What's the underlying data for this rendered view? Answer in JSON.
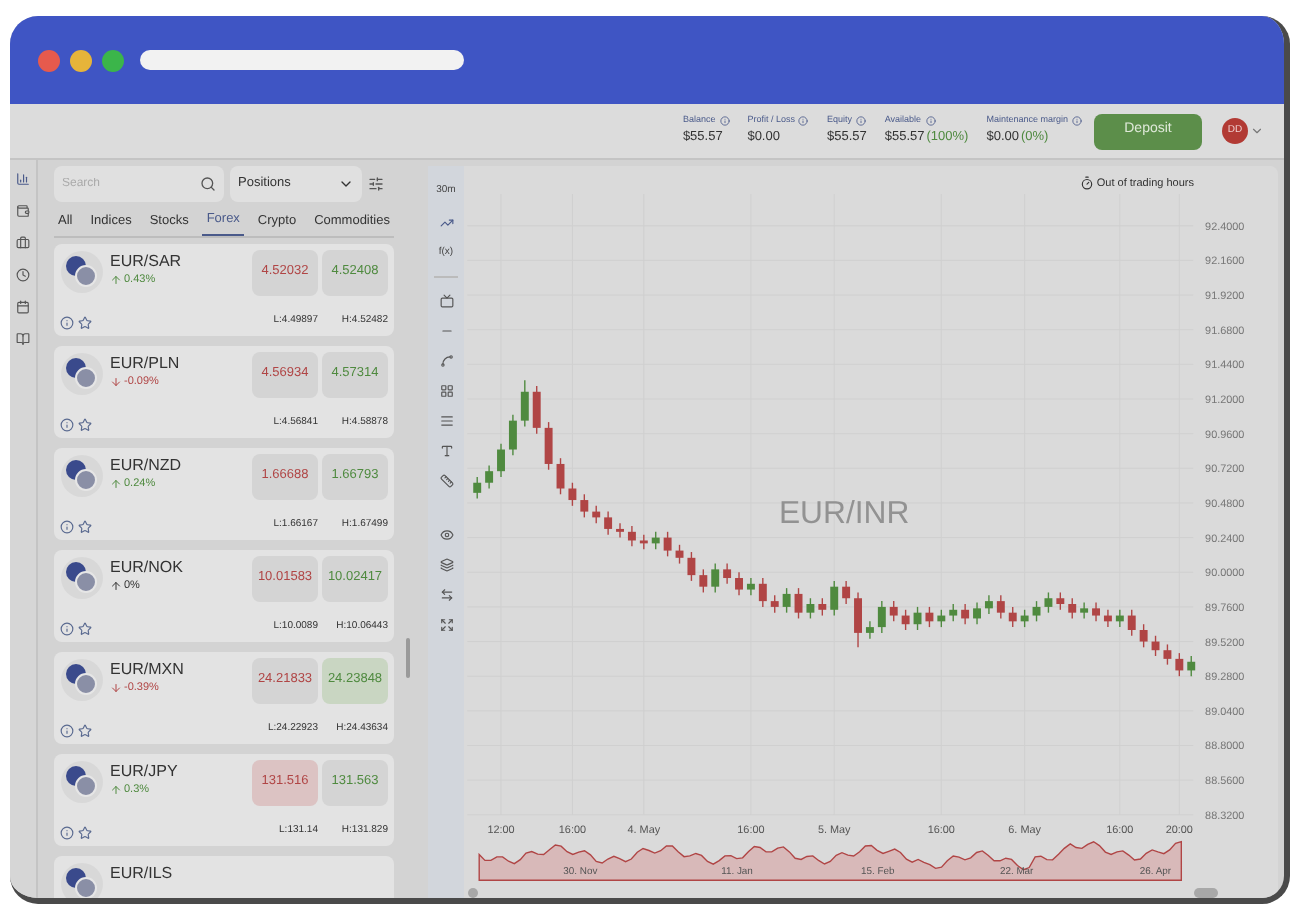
{
  "account": [
    {
      "label": "Balance",
      "value": "$55.57"
    },
    {
      "label": "Profit / Loss",
      "value": "$0.00"
    },
    {
      "label": "Equity",
      "value": "$55.57"
    },
    {
      "label": "Available",
      "value": "$55.57",
      "percent": "(100%)"
    },
    {
      "label": "Maintenance margin",
      "value": "$0.00",
      "percent": "(0%)"
    }
  ],
  "deposit_button": "Deposit",
  "avatar": "DD",
  "search": {
    "placeholder": "Search"
  },
  "view_select": "Positions",
  "tabs": [
    {
      "label": "All",
      "selected": false
    },
    {
      "label": "Indices",
      "selected": false
    },
    {
      "label": "Stocks",
      "selected": false
    },
    {
      "label": "Forex",
      "selected": true
    },
    {
      "label": "Crypto",
      "selected": false
    },
    {
      "label": "Commodities",
      "selected": false
    }
  ],
  "instruments": [
    {
      "pair": "EUR/SAR",
      "change": "0.43%",
      "falling": false,
      "unchanged": false,
      "sell": {
        "price": "4.52032",
        "highlighted": false
      },
      "buy": {
        "price": "4.52408",
        "highlighted": false
      },
      "low": "L:4.49897",
      "high": "H:4.52482"
    },
    {
      "pair": "EUR/PLN",
      "change": "-0.09%",
      "falling": true,
      "unchanged": false,
      "sell": {
        "price": "4.56934",
        "highlighted": false
      },
      "buy": {
        "price": "4.57314",
        "highlighted": false
      },
      "low": "L:4.56841",
      "high": "H:4.58878"
    },
    {
      "pair": "EUR/NZD",
      "change": "0.24%",
      "falling": false,
      "unchanged": false,
      "sell": {
        "price": "1.66688",
        "highlighted": false
      },
      "buy": {
        "price": "1.66793",
        "highlighted": false
      },
      "low": "L:1.66167",
      "high": "H:1.67499"
    },
    {
      "pair": "EUR/NOK",
      "change": "0%",
      "falling": false,
      "unchanged": true,
      "sell": {
        "price": "10.01583",
        "highlighted": false
      },
      "buy": {
        "price": "10.02417",
        "highlighted": false
      },
      "low": "L:10.0089",
      "high": "H:10.06443"
    },
    {
      "pair": "EUR/MXN",
      "change": "-0.39%",
      "falling": true,
      "unchanged": false,
      "sell": {
        "price": "24.21833",
        "highlighted": false
      },
      "buy": {
        "price": "24.23848",
        "highlighted": true
      },
      "low": "L:24.22923",
      "high": "H:24.43634"
    },
    {
      "pair": "EUR/JPY",
      "change": "0.3%",
      "falling": false,
      "unchanged": false,
      "sell": {
        "price": "131.516",
        "highlighted": true
      },
      "buy": {
        "price": "131.563",
        "highlighted": false
      },
      "low": "L:131.14",
      "high": "H:131.829"
    },
    {
      "pair": "EUR/ILS"
    }
  ],
  "chart": {
    "interval": "30m",
    "indicator_button": "f(x)",
    "status": "Out of trading hours",
    "watermark": "EUR/INR",
    "chart_data": {
      "type": "candlestick",
      "categories": [
        null,
        null,
        "12:00",
        null,
        null,
        null,
        null,
        null,
        "16:00",
        null,
        null,
        null,
        null,
        null,
        "4. May",
        null,
        null,
        null,
        null,
        null,
        null,
        null,
        null,
        "16:00",
        null,
        null,
        null,
        null,
        null,
        null,
        "5. May",
        null,
        null,
        null,
        null,
        null,
        null,
        null,
        null,
        "16:00",
        null,
        null,
        null,
        null,
        null,
        null,
        "6. May",
        null,
        null,
        null,
        null,
        null,
        null,
        null,
        "16:00",
        null,
        null,
        null,
        null,
        "20:00",
        null
      ],
      "ohlc": [
        [
          90.55,
          90.66,
          90.51,
          90.62
        ],
        [
          90.62,
          90.74,
          90.58,
          90.7
        ],
        [
          90.7,
          90.89,
          90.66,
          90.85
        ],
        [
          90.85,
          91.09,
          90.81,
          91.05
        ],
        [
          91.05,
          91.33,
          91.01,
          91.25
        ],
        [
          91.25,
          91.29,
          90.96,
          91.0
        ],
        [
          91.0,
          91.04,
          90.71,
          90.75
        ],
        [
          90.75,
          90.79,
          90.54,
          90.58
        ],
        [
          90.58,
          90.62,
          90.46,
          90.5
        ],
        [
          90.5,
          90.54,
          90.38,
          90.42
        ],
        [
          90.42,
          90.46,
          90.34,
          90.38
        ],
        [
          90.38,
          90.42,
          90.26,
          90.3
        ],
        [
          90.3,
          90.34,
          90.24,
          90.28
        ],
        [
          90.28,
          90.32,
          90.18,
          90.22
        ],
        [
          90.22,
          90.26,
          90.16,
          90.2
        ],
        [
          90.2,
          90.28,
          90.16,
          90.24
        ],
        [
          90.24,
          90.28,
          90.11,
          90.15
        ],
        [
          90.15,
          90.19,
          90.06,
          90.1
        ],
        [
          90.1,
          90.14,
          89.94,
          89.98
        ],
        [
          89.98,
          90.02,
          89.86,
          89.9
        ],
        [
          89.9,
          90.06,
          89.86,
          90.02
        ],
        [
          90.02,
          90.06,
          89.92,
          89.96
        ],
        [
          89.96,
          90.0,
          89.84,
          89.88
        ],
        [
          89.88,
          89.96,
          89.84,
          89.92
        ],
        [
          89.92,
          89.96,
          89.76,
          89.8
        ],
        [
          89.8,
          89.84,
          89.72,
          89.76
        ],
        [
          89.76,
          89.89,
          89.72,
          89.85
        ],
        [
          89.85,
          89.89,
          89.68,
          89.72
        ],
        [
          89.72,
          89.82,
          89.68,
          89.78
        ],
        [
          89.78,
          89.82,
          89.7,
          89.74
        ],
        [
          89.74,
          89.94,
          89.7,
          89.9
        ],
        [
          89.9,
          89.94,
          89.78,
          89.82
        ],
        [
          89.82,
          89.86,
          89.48,
          89.58
        ],
        [
          89.58,
          89.66,
          89.54,
          89.62
        ],
        [
          89.62,
          89.8,
          89.58,
          89.76
        ],
        [
          89.76,
          89.8,
          89.66,
          89.7
        ],
        [
          89.7,
          89.74,
          89.6,
          89.64
        ],
        [
          89.64,
          89.76,
          89.6,
          89.72
        ],
        [
          89.72,
          89.76,
          89.62,
          89.66
        ],
        [
          89.66,
          89.74,
          89.62,
          89.7
        ],
        [
          89.7,
          89.78,
          89.66,
          89.74
        ],
        [
          89.74,
          89.78,
          89.64,
          89.68
        ],
        [
          89.68,
          89.79,
          89.64,
          89.75
        ],
        [
          89.75,
          89.84,
          89.71,
          89.8
        ],
        [
          89.8,
          89.84,
          89.68,
          89.72
        ],
        [
          89.72,
          89.76,
          89.62,
          89.66
        ],
        [
          89.66,
          89.74,
          89.62,
          89.7
        ],
        [
          89.7,
          89.8,
          89.66,
          89.76
        ],
        [
          89.76,
          89.86,
          89.72,
          89.82
        ],
        [
          89.82,
          89.86,
          89.74,
          89.78
        ],
        [
          89.78,
          89.82,
          89.68,
          89.72
        ],
        [
          89.72,
          89.79,
          89.68,
          89.75
        ],
        [
          89.75,
          89.79,
          89.66,
          89.7
        ],
        [
          89.7,
          89.74,
          89.62,
          89.66
        ],
        [
          89.66,
          89.74,
          89.62,
          89.7
        ],
        [
          89.7,
          89.74,
          89.56,
          89.6
        ],
        [
          89.6,
          89.64,
          89.48,
          89.52
        ],
        [
          89.52,
          89.56,
          89.42,
          89.46
        ],
        [
          89.46,
          89.5,
          89.36,
          89.4
        ],
        [
          89.4,
          89.44,
          89.28,
          89.32
        ],
        [
          89.32,
          89.42,
          89.28,
          89.38
        ]
      ],
      "ylim": [
        88.32,
        92.4
      ],
      "grid": true,
      "yticks": [
        {
          "value": 92.4,
          "label": "92.4000"
        },
        {
          "value": 92.16,
          "label": "92.1600"
        },
        {
          "value": 91.92,
          "label": "91.9200"
        },
        {
          "value": 91.68,
          "label": "91.6800"
        },
        {
          "value": 91.44,
          "label": "91.4400"
        },
        {
          "value": 91.2,
          "label": "91.2000"
        },
        {
          "value": 90.96,
          "label": "90.9600"
        },
        {
          "value": 90.72,
          "label": "90.7200"
        },
        {
          "value": 90.48,
          "label": "90.4800"
        },
        {
          "value": 90.24,
          "label": "90.2400"
        },
        {
          "value": 90.0,
          "label": "90.0000"
        },
        {
          "value": 89.76,
          "label": "89.7600"
        },
        {
          "value": 89.52,
          "label": "89.5200"
        },
        {
          "value": 89.28,
          "label": "89.2800"
        },
        {
          "value": 89.04,
          "label": "89.0400"
        },
        {
          "value": 88.8,
          "label": "88.8000"
        },
        {
          "value": 88.56,
          "label": "88.5600"
        },
        {
          "value": 88.32,
          "label": "88.3200"
        }
      ]
    },
    "navigator_labels": [
      "30. Nov",
      "11. Jan",
      "15. Feb",
      "22. Mar",
      "26. Apr"
    ]
  }
}
